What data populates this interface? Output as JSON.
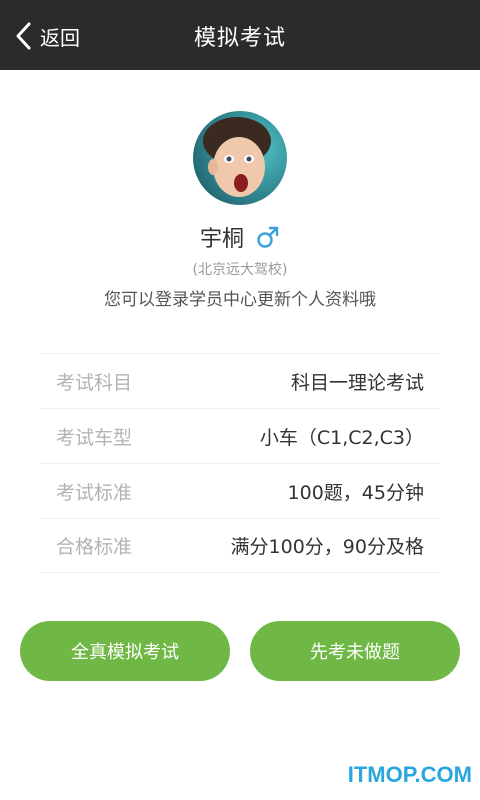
{
  "header": {
    "back_label": "返回",
    "title": "模拟考试"
  },
  "profile": {
    "name": "宇桐",
    "gender": "male",
    "school": "(北京远大驾校)",
    "tip": "您可以登录学员中心更新个人资料哦"
  },
  "exam_info": [
    {
      "label": "考试科目",
      "value": "科目一理论考试"
    },
    {
      "label": "考试车型",
      "value": "小车（C1,C2,C3）"
    },
    {
      "label": "考试标准",
      "value": "100题，45分钟"
    },
    {
      "label": "合格标准",
      "value": "满分100分，90分及格"
    }
  ],
  "buttons": {
    "full_exam": "全真模拟考试",
    "undone_first": "先考未做题"
  },
  "watermark": "ITMOP.COM",
  "colors": {
    "topbar": "#2b2b2d",
    "accent_green": "#6fb845",
    "gender_blue": "#3aa0dc"
  }
}
